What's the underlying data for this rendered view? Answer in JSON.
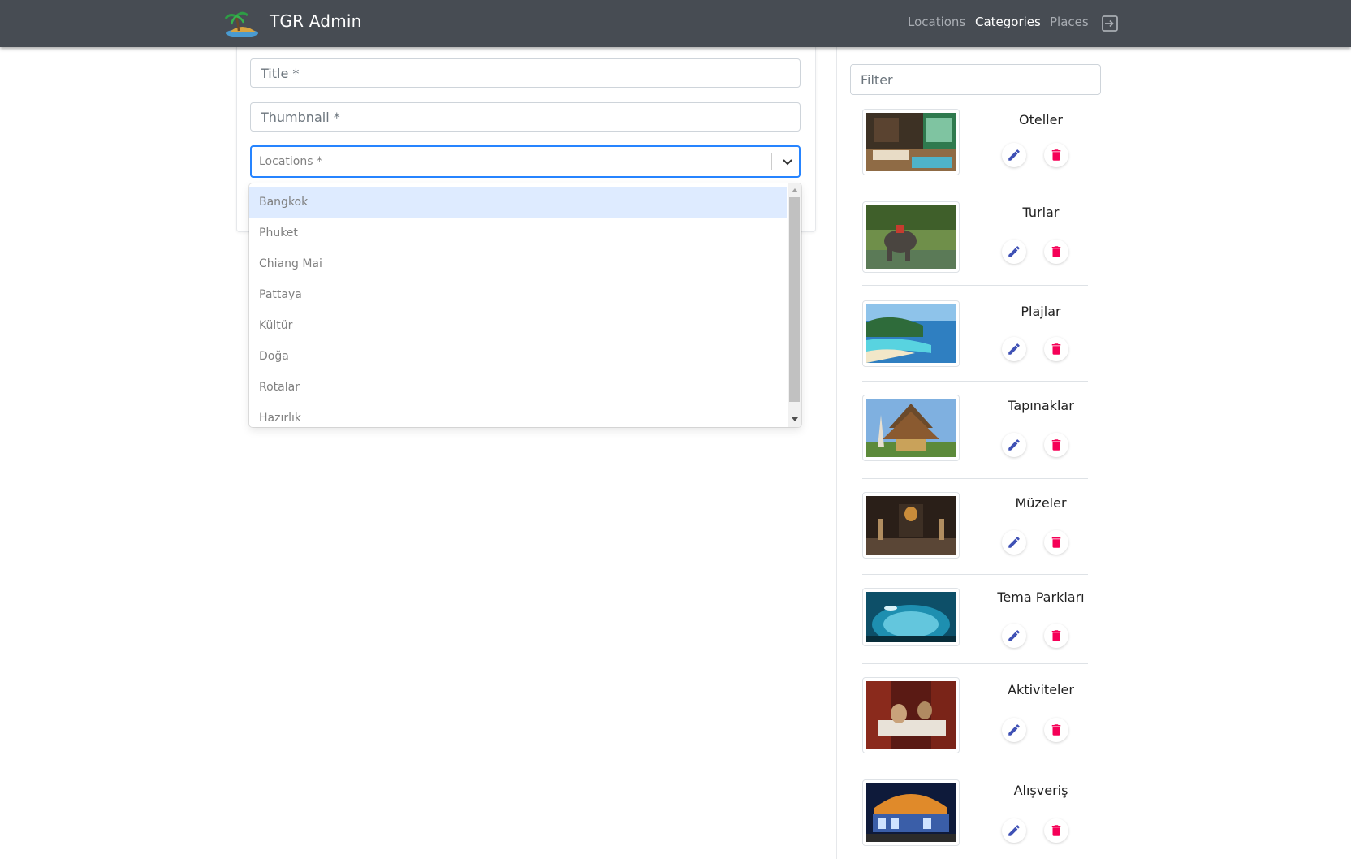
{
  "navbar": {
    "brand": "TGR Admin",
    "links": [
      {
        "label": "Locations",
        "active": false
      },
      {
        "label": "Categories",
        "active": true
      },
      {
        "label": "Places",
        "active": false
      }
    ],
    "logout_icon": "logout-icon"
  },
  "form": {
    "title_placeholder": "Title *",
    "thumbnail_placeholder": "Thumbnail *",
    "locations_placeholder": "Locations *",
    "locations_options": [
      "Bangkok",
      "Phuket",
      "Chiang Mai",
      "Pattaya",
      "Kültür",
      "Doğa",
      "Rotalar",
      "Hazırlık"
    ],
    "focused_option": "Bangkok"
  },
  "panel": {
    "filter_placeholder": "Filter",
    "categories": [
      {
        "title": "Oteller",
        "image": "hotel-image"
      },
      {
        "title": "Turlar",
        "image": "elephant-tour-image"
      },
      {
        "title": "Plajlar",
        "image": "beach-image"
      },
      {
        "title": "Tapınaklar",
        "image": "temple-image"
      },
      {
        "title": "Müzeler",
        "image": "museum-image"
      },
      {
        "title": "Tema Parkları",
        "image": "aquarium-image"
      },
      {
        "title": "Aktiviteler",
        "image": "massage-image"
      },
      {
        "title": "Alışveriş",
        "image": "mall-image"
      }
    ],
    "edit_icon": "pencil-icon",
    "delete_icon": "trash-icon"
  },
  "colors": {
    "navbar": "#474c53",
    "focus_border": "#2684ff",
    "option_focus": "#deebff",
    "edit_icon": "#3f51b5",
    "delete_icon": "#f50057"
  }
}
